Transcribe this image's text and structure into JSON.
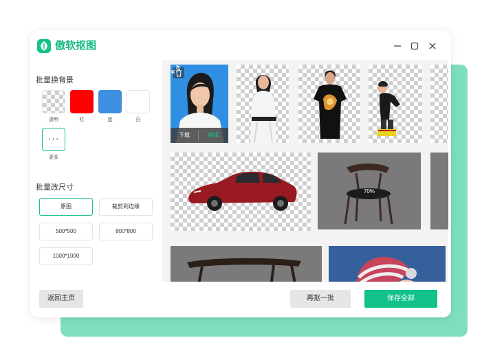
{
  "app": {
    "title": "傲软抠图"
  },
  "sidebar": {
    "bg_section_title": "批量换背景",
    "swatches": [
      {
        "label": "透明",
        "color": "transparent"
      },
      {
        "label": "红",
        "color": "#ff0000"
      },
      {
        "label": "蓝",
        "color": "#3d8fe0"
      },
      {
        "label": "白",
        "color": "#ffffff"
      }
    ],
    "more": {
      "symbol": "···",
      "label": "更多"
    },
    "size_section_title": "批量改尺寸",
    "size_options": [
      "原图",
      "裁剪到边缘",
      "500*500",
      "800*800",
      "1000*1000"
    ]
  },
  "gallery": {
    "hover_actions": {
      "download": "下载",
      "edit": "编辑"
    },
    "processing_percent": "70%"
  },
  "footer": {
    "home_label": "返回主页",
    "again_label": "再抠一批",
    "save_all_label": "保存全部"
  },
  "colors": {
    "accent": "#12c28a",
    "red": "#ff0000",
    "blue": "#3d8fe0"
  }
}
